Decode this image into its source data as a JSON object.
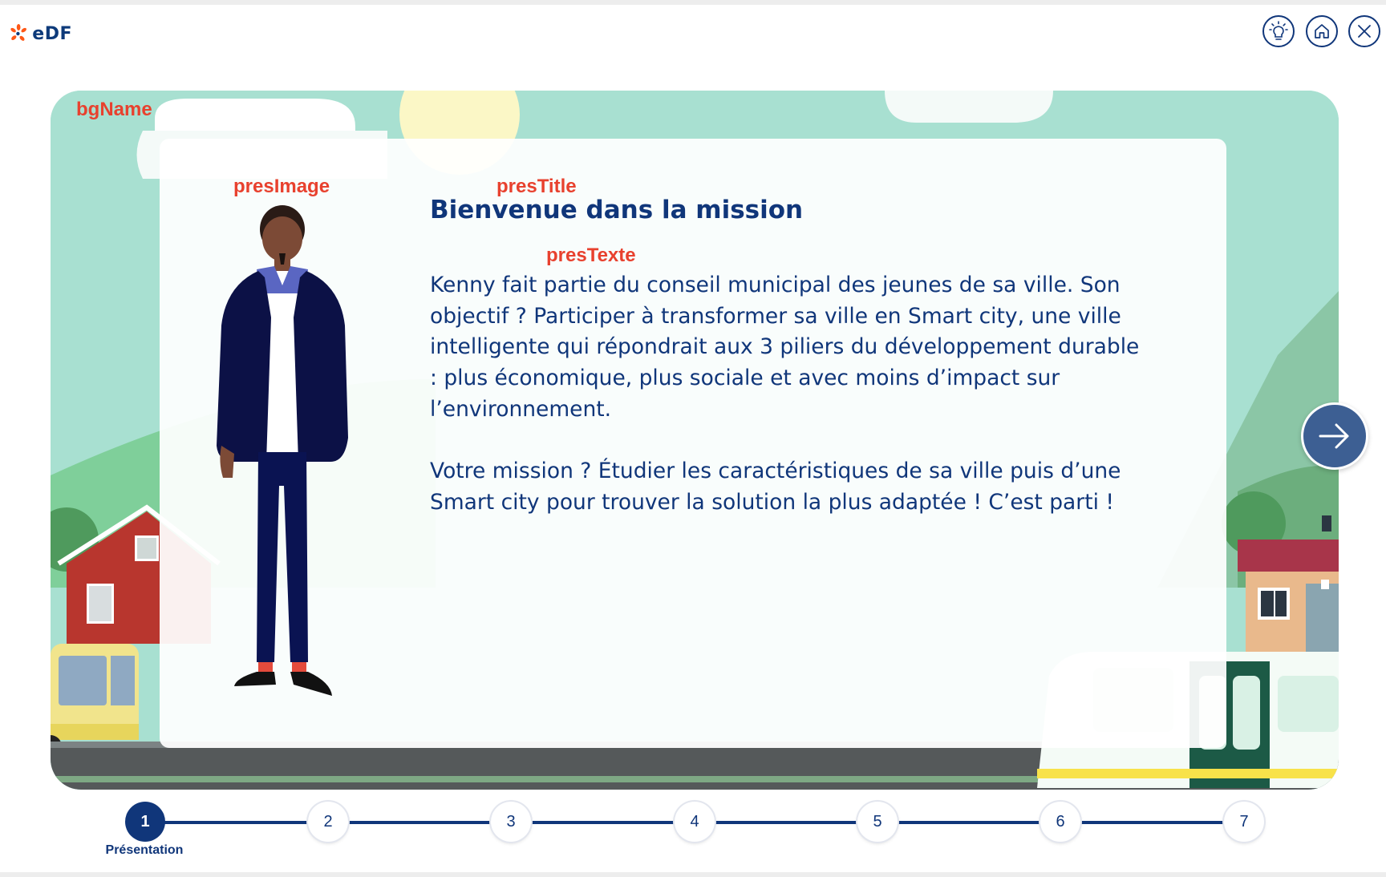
{
  "app": {
    "logo_text": "eDF"
  },
  "header": {
    "buttons": [
      "hint-icon",
      "home-icon",
      "close-icon"
    ]
  },
  "placeholders": {
    "bg": "bgName",
    "image": "presImage",
    "title": "presTitle",
    "text": "presTexte"
  },
  "presentation": {
    "title": "Bienvenue dans la mission",
    "paragraph1": "Kenny fait partie du conseil municipal des jeunes de sa ville. Son objectif ? Participer à transformer sa ville en Smart city, une ville intelligente qui répondrait aux 3 piliers du développement durable : plus économique, plus sociale et avec moins d’impact sur l’environnement.",
    "paragraph2": "Votre mission ? Étudier les caractéristiques de sa ville puis d’une Smart city pour trouver la solution la plus adaptée ! C’est parti !"
  },
  "navigation": {
    "next_icon": "arrow-right-icon"
  },
  "stepper": {
    "steps": [
      "1",
      "2",
      "3",
      "4",
      "5",
      "6",
      "7"
    ],
    "active_index": 0,
    "active_caption": "Présentation"
  },
  "colors": {
    "brand_navy": "#10367a",
    "placeholder_red": "#e8412e",
    "next_button": "#3d5f93",
    "edf_orange": "#fe5716"
  }
}
